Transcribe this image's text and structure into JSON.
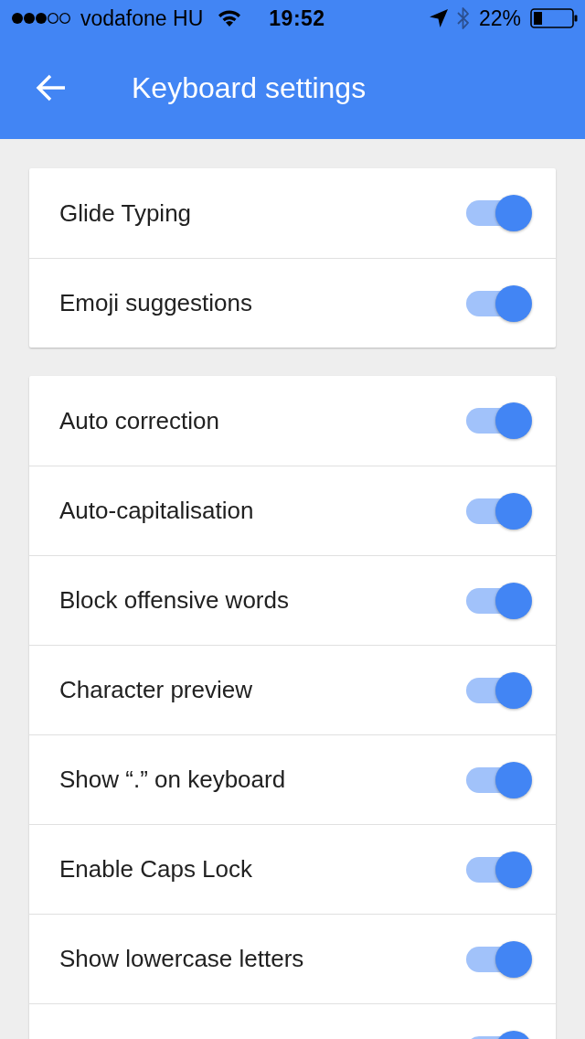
{
  "status_bar": {
    "carrier": "vodafone HU",
    "time": "19:52",
    "battery": "22%"
  },
  "app_bar": {
    "title": "Keyboard settings"
  },
  "sections": [
    {
      "items": [
        {
          "label": "Glide Typing",
          "on": true
        },
        {
          "label": "Emoji suggestions",
          "on": true
        }
      ]
    },
    {
      "items": [
        {
          "label": "Auto correction",
          "on": true
        },
        {
          "label": "Auto-capitalisation",
          "on": true
        },
        {
          "label": "Block offensive words",
          "on": true
        },
        {
          "label": "Character preview",
          "on": true
        },
        {
          "label": "Show “.” on keyboard",
          "on": true
        },
        {
          "label": "Enable Caps Lock",
          "on": true
        },
        {
          "label": "Show lowercase letters",
          "on": true
        },
        {
          "on": true
        }
      ]
    }
  ]
}
